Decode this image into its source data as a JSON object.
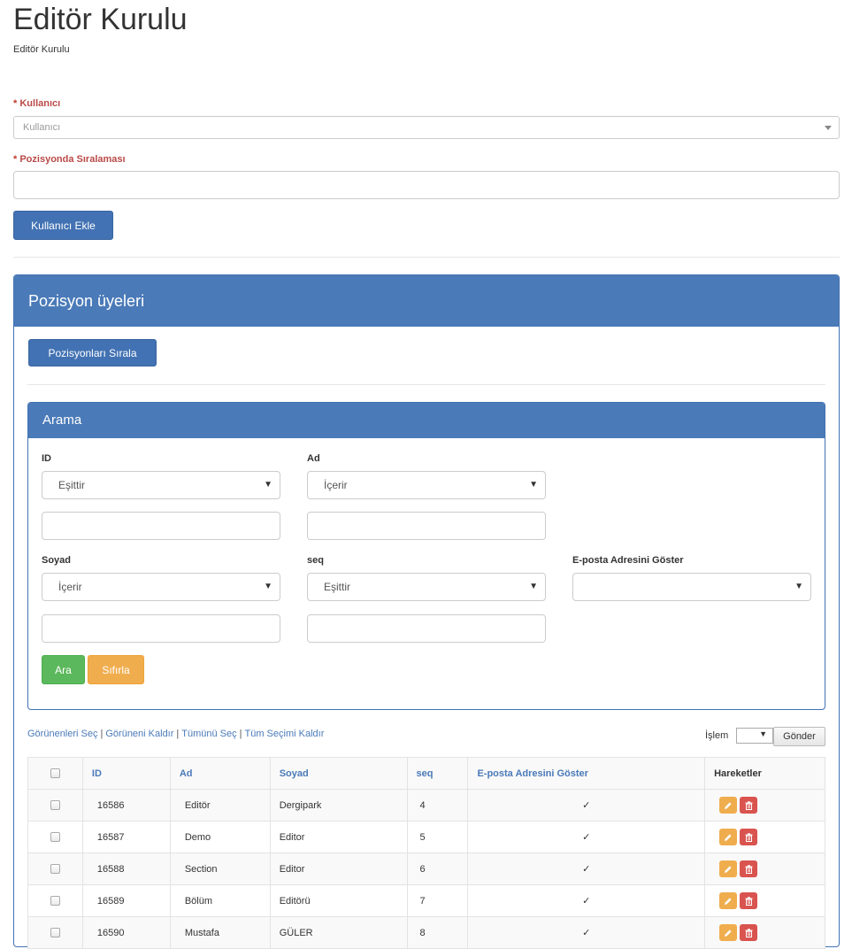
{
  "header": {
    "title": "Editör Kurulu",
    "breadcrumb": "Editör Kurulu"
  },
  "form": {
    "user_label": "Kullanıcı",
    "user_placeholder": "Kullanıcı",
    "order_label": "Pozisyonda Sıralaması",
    "required_mark": "*",
    "add_button": "Kullanıcı Ekle"
  },
  "members_panel": {
    "title": "Pozisyon üyeleri",
    "sort_button": "Pozisyonları Sırala"
  },
  "search": {
    "title": "Arama",
    "filters": [
      {
        "label": "ID",
        "operator": "Eşittir"
      },
      {
        "label": "Ad",
        "operator": "İçerir"
      },
      {
        "label": "Soyad",
        "operator": "İçerir"
      },
      {
        "label": "seq",
        "operator": "Eşittir"
      },
      {
        "label": "E-posta Adresini Göster",
        "operator": ""
      }
    ],
    "search_button": "Ara",
    "reset_button": "Sıfırla"
  },
  "bulk": {
    "select_visible": "Görünenleri Seç",
    "deselect_visible": "Görüneni Kaldır",
    "select_all": "Tümünü Seç",
    "deselect_all": "Tüm Seçimi Kaldır",
    "separator": "|",
    "action_label": "İşlem",
    "send_button": "Gönder"
  },
  "table": {
    "columns": [
      "ID",
      "Ad",
      "Soyad",
      "seq",
      "E-posta Adresini Göster",
      "Hareketler"
    ],
    "rows": [
      {
        "id": "16586",
        "ad": "Editör",
        "soyad": "Dergipark",
        "seq": "4",
        "email": "✓"
      },
      {
        "id": "16587",
        "ad": "Demo",
        "soyad": "Editor",
        "seq": "5",
        "email": "✓"
      },
      {
        "id": "16588",
        "ad": "Section",
        "soyad": "Editor",
        "seq": "6",
        "email": "✓"
      },
      {
        "id": "16589",
        "ad": "Bölüm",
        "soyad": "Editörü",
        "seq": "7",
        "email": "✓"
      },
      {
        "id": "16590",
        "ad": "Mustafa",
        "soyad": "GÜLER",
        "seq": "8",
        "email": "✓"
      }
    ]
  },
  "icons": {
    "edit": "pencil-icon",
    "delete": "trash-icon",
    "caret": "caret-down-icon"
  },
  "colors": {
    "primary": "#4272b3",
    "success": "#5cb85c",
    "warning": "#f0ad4e",
    "danger": "#d9534f",
    "required": "#b94a48"
  }
}
